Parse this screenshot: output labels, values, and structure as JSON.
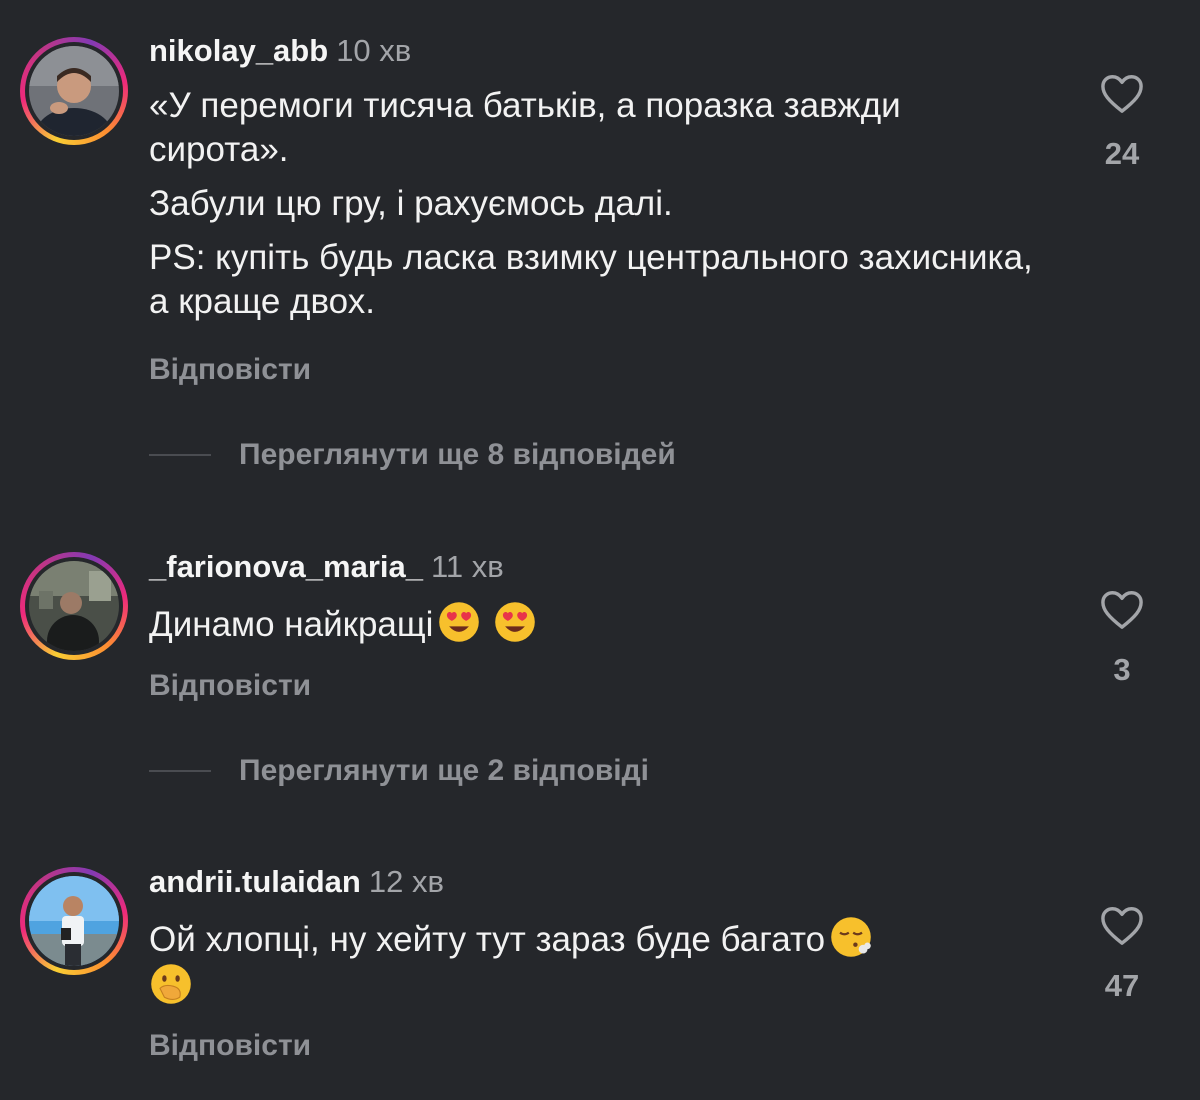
{
  "comments": [
    {
      "username": "nikolay_abb",
      "time": "10 хв",
      "paragraphs": [
        "«У перемоги тисяча батьків, а поразка завжди сирота».",
        "Забули цю гру, і рахуємось далі.",
        "PS: купіть будь ласка взимку центрального захисника, а краще двох."
      ],
      "likes": "24",
      "reply_label": "Відповісти",
      "view_replies_label": "Переглянути ще 8 відповідей"
    },
    {
      "username": "_farionova_maria_",
      "time": "11 хв",
      "text": "Динамо найкращі",
      "emojis": [
        "heart-eyes-emoji",
        "heart-eyes-emoji"
      ],
      "likes": "3",
      "reply_label": "Відповісти",
      "view_replies_label": "Переглянути ще 2 відповіді"
    },
    {
      "username": "andrii.tulaidan",
      "time": "12 хв",
      "text": "Ой хлопці, ну хейту тут зараз буде багато",
      "emojis": [
        "face-exhaling-emoji",
        "face-with-hand-over-mouth-emoji"
      ],
      "likes": "47",
      "reply_label": "Відповісти"
    }
  ],
  "colors": {
    "background": "#25272b",
    "text": "#f2f2f2",
    "muted": "#8f9196",
    "ring_gradient": [
      "#f9ce34",
      "#ee2a7b",
      "#833ab4"
    ]
  }
}
